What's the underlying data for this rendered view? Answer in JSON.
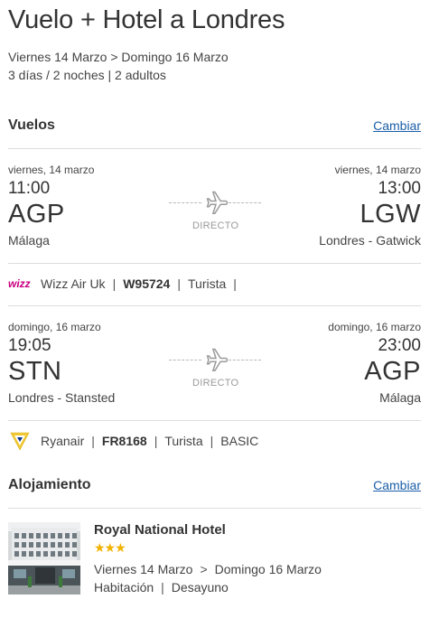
{
  "header": {
    "title": "Vuelo + Hotel a Londres",
    "dates": "Viernes 14 Marzo > Domingo 16 Marzo",
    "summary": "3 días / 2 noches | 2 adultos"
  },
  "flights_section": {
    "heading": "Vuelos",
    "change_link": "Cambiar"
  },
  "outbound": {
    "depart_date": "viernes, 14 marzo",
    "depart_time": "11:00",
    "depart_code": "AGP",
    "depart_city": "Málaga",
    "arrive_date": "viernes, 14 marzo",
    "arrive_time": "13:00",
    "arrive_code": "LGW",
    "arrive_city": "Londres - Gatwick",
    "stops": "DIRECTO",
    "airline": "Wizz Air Uk",
    "flight_number": "W95724",
    "cabin": "Turista",
    "airline_logo": "wizz-logo"
  },
  "return": {
    "depart_date": "domingo, 16 marzo",
    "depart_time": "19:05",
    "depart_code": "STN",
    "depart_city": "Londres - Stansted",
    "arrive_date": "domingo, 16 marzo",
    "arrive_time": "23:00",
    "arrive_code": "AGP",
    "arrive_city": "Málaga",
    "stops": "DIRECTO",
    "airline": "Ryanair",
    "flight_number": "FR8168",
    "cabin": "Turista",
    "fare": "BASIC",
    "airline_logo": "ryanair-logo"
  },
  "hotel_section": {
    "heading": "Alojamiento",
    "change_link": "Cambiar"
  },
  "hotel": {
    "name": "Royal National Hotel",
    "stars": 3,
    "stars_text": "★★★",
    "checkin": "Viernes 14 Marzo",
    "arrow": ">",
    "checkout": "Domingo 16 Marzo",
    "room": "Habitación",
    "board": "Desayuno"
  },
  "colors": {
    "link": "#1a5ea8",
    "star": "#f2b200",
    "wizz": "#c6007e",
    "ryanair_gold": "#f1c933",
    "ryanair_blue": "#073590"
  }
}
